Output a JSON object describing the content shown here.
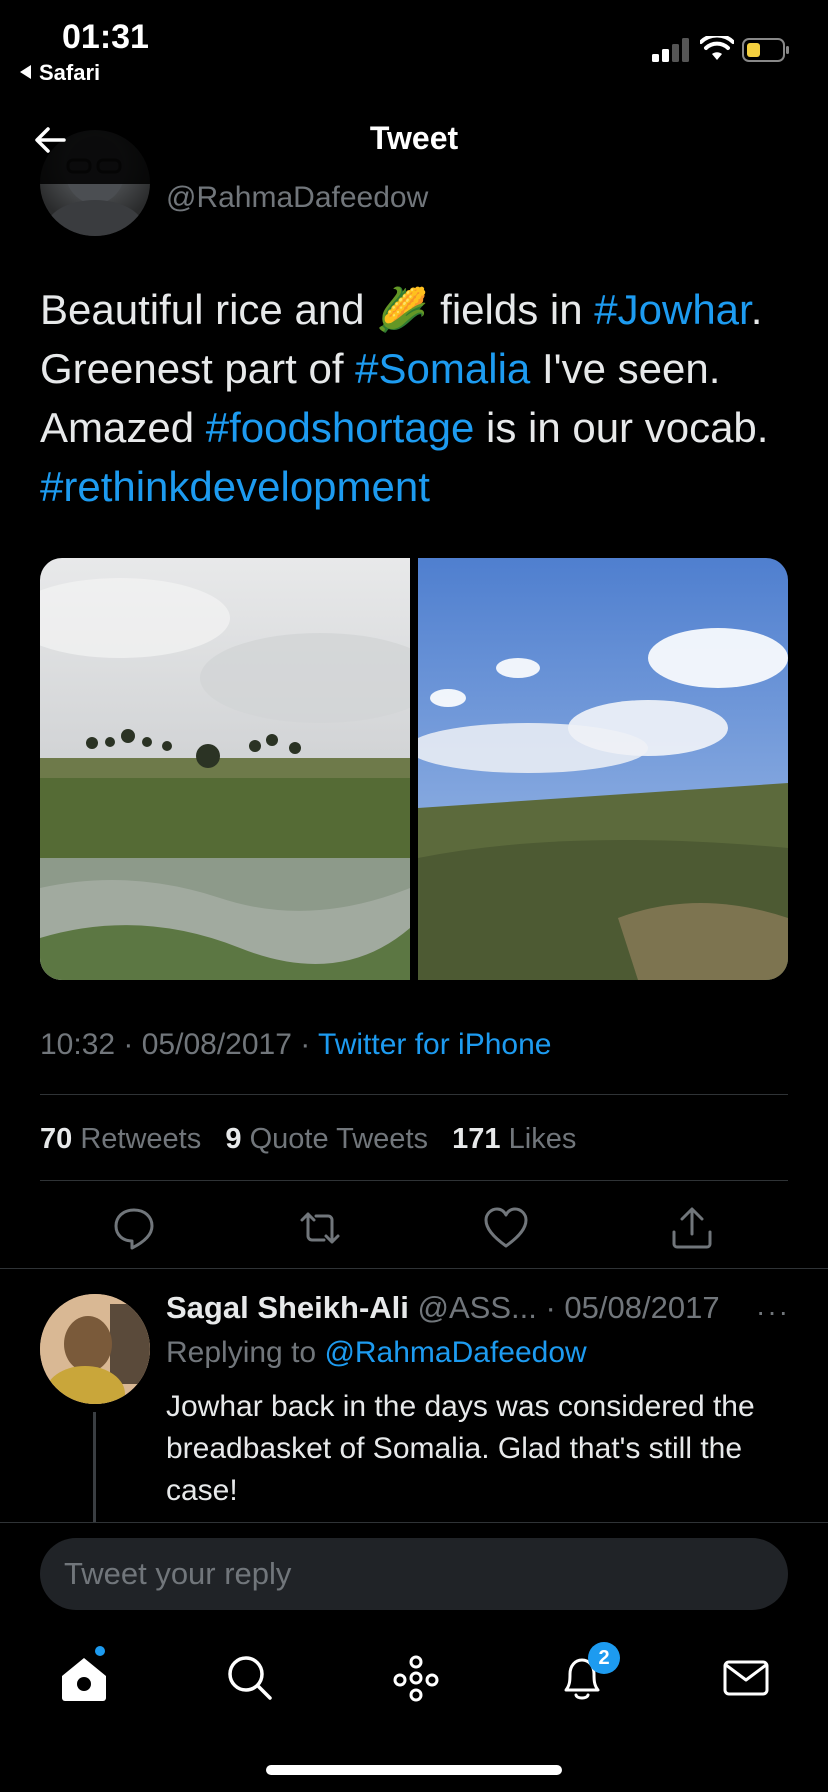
{
  "status_bar": {
    "time": "01:31",
    "back_app": "Safari"
  },
  "header": {
    "title": "Tweet"
  },
  "tweet": {
    "handle": "@RahmaDafeedow",
    "text_parts": {
      "p1": "Beautiful rice and ",
      "emoji": "🌽",
      "p2": " fields in ",
      "tag1": "#Jowhar",
      "p3": ". Greenest part of ",
      "tag2": "#Somalia",
      "p4": " I've seen. Amazed ",
      "tag3": "#foodshortage",
      "p5": " is in our vocab. ",
      "tag4": "#rethinkdevelopment"
    },
    "time": "10:32",
    "date": "05/08/2017",
    "source": "Twitter for iPhone",
    "stats": {
      "retweets_count": "70",
      "retweets_label": "Retweets",
      "quotes_count": "9",
      "quotes_label": "Quote Tweets",
      "likes_count": "171",
      "likes_label": "Likes"
    }
  },
  "reply": {
    "name": "Sagal Sheikh-Ali",
    "handle": "@ASS...",
    "date": "· 05/08/2017",
    "more": "···",
    "replying_prefix": "Replying to ",
    "replying_to": "@RahmaDafeedow",
    "text": "Jowhar back in the days was considered the breadbasket of Somalia. Glad that's still the case!"
  },
  "composer": {
    "placeholder": "Tweet your reply"
  },
  "tabbar": {
    "notifications_badge": "2"
  },
  "colors": {
    "accent": "#1d9bf0",
    "background": "#000000",
    "muted": "#71767b"
  }
}
